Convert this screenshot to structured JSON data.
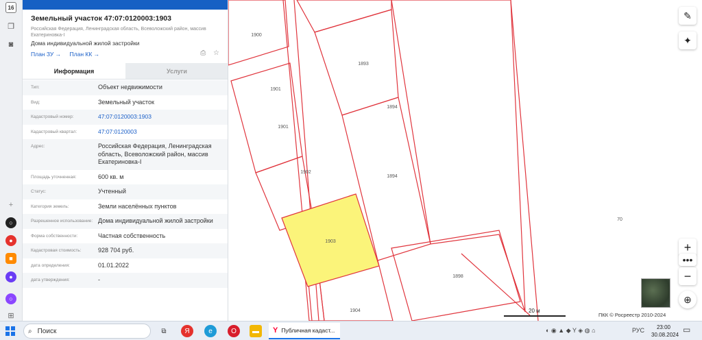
{
  "rail": {
    "badge_number": "16"
  },
  "panel": {
    "title": "Земельный участок 47:07:0120003:1903",
    "address": "Российская Федерация, Ленинградская область, Всеволожский район, массив Екатериновка-I",
    "purpose": "Дома индивидуальной жилой застройки",
    "links": [
      "План ЗУ →",
      "План КК →"
    ],
    "tabs": [
      {
        "label": "Информация",
        "active": true
      },
      {
        "label": "Услуги",
        "active": false
      }
    ],
    "rows": [
      {
        "key": "Тип:",
        "value": "Объект недвижимости"
      },
      {
        "key": "Вид:",
        "value": "Земельный участок"
      },
      {
        "key": "Кадастровый номер:",
        "value": "47:07:0120003:1903"
      },
      {
        "key": "Кадастровый квартал:",
        "value": "47:07:0120003"
      },
      {
        "key": "Адрес:",
        "value": "Российская Федерация, Ленинградская область, Всеволожский район, массив Екатериновка-I"
      },
      {
        "key": "Площадь уточненная:",
        "value": "600 кв. м"
      },
      {
        "key": "Статус:",
        "value": "Учтенный"
      },
      {
        "key": "Категория земель:",
        "value": "Земли населённых пунктов"
      },
      {
        "key": "Разрешенное использование:",
        "value": "Дома индивидуальной жилой застройки"
      },
      {
        "key": "Форма собственности:",
        "value": "Частная собственность"
      },
      {
        "key": "Кадастровая стоимость:",
        "value": "928 704 руб."
      },
      {
        "key": "дата определения:",
        "value": "01.01.2022"
      },
      {
        "key": "дата утверждения:",
        "value": "-"
      }
    ]
  },
  "map": {
    "parcels": [
      "1900",
      "1893",
      "1901",
      "1894",
      "1901",
      "1902",
      "1894",
      "1903",
      "70",
      "1898",
      "1904"
    ],
    "selected_parcel": "1903",
    "selected_color": "#fbf47a",
    "border_color": "#e0343c",
    "scale_label": "20 м",
    "copyright": "ПКК © Росреестр 2010-2024",
    "tools": [
      "ruler-icon",
      "locate-icon",
      "zoom-in-icon",
      "more-icon",
      "zoom-out-icon",
      "compass-icon"
    ]
  },
  "taskbar": {
    "search_label": "Поиск",
    "active_task_label": "Публичная кадаст...",
    "language": "РУС",
    "time": "23:00",
    "date": "30.08.2024"
  }
}
